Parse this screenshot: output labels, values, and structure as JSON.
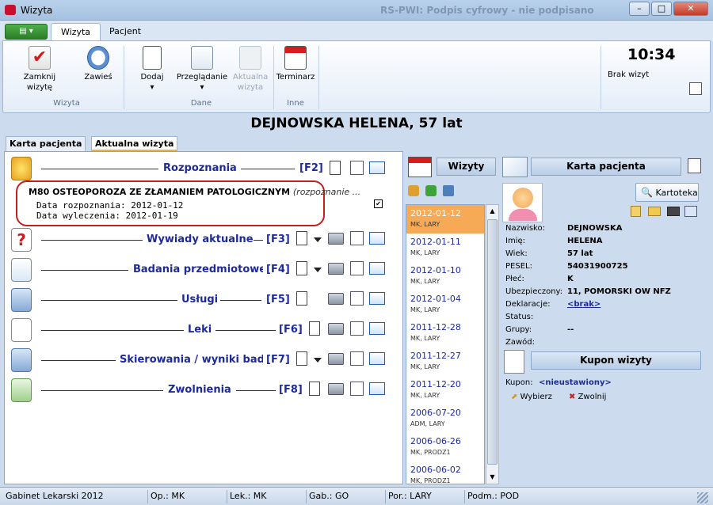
{
  "window": {
    "title": "Wizyta",
    "background_title": "RS-PWI: Podpis cyfrowy - nie podpisano"
  },
  "ribbon": {
    "tabs": [
      "Wizyta",
      "Pacjent"
    ],
    "buttons": {
      "zamknij": "Zamknij wizytę",
      "zawies": "Zawieś",
      "dodaj": "Dodaj",
      "przegladanie": "Przeglądanie",
      "aktualna1": "Aktualna",
      "aktualna2": "wizyta",
      "terminarz": "Terminarz"
    },
    "groups": {
      "wizyta": "Wizyta",
      "dane": "Dane",
      "inne": "Inne"
    },
    "clock": "10:34",
    "status": "Brak wizyt"
  },
  "patient": {
    "header": "DEJNOWSKA HELENA, 57 lat"
  },
  "patient_tabs": [
    "Karta pacjenta",
    "Aktualna wizyta"
  ],
  "sections": [
    {
      "label": "Rozpoznania",
      "key": "[F2]"
    },
    {
      "label": "Wywiady aktualne",
      "key": "[F3]"
    },
    {
      "label": "Badania przedmiotowe",
      "key": "[F4]"
    },
    {
      "label": "Usługi",
      "key": "[F5]"
    },
    {
      "label": "Leki",
      "key": "[F6]"
    },
    {
      "label": "Skierowania / wyniki badań",
      "key": "[F7]"
    },
    {
      "label": "Zwolnienia",
      "key": "[F8]"
    }
  ],
  "diagnosis": {
    "title": "M80 OSTEOPOROZA ZE ZŁAMANIEM PATOLOGICZNYM",
    "note": "(rozpoznanie ...",
    "rozpoznanie": "Data rozpoznania: 2012-01-12",
    "wyleczenie": "Data wyleczenia: 2012-01-19"
  },
  "visits": {
    "title": "Wizyty",
    "items": [
      {
        "date": "2012-01-12",
        "code": "MK, LARY",
        "selected": true
      },
      {
        "date": "2012-01-11",
        "code": "MK, LARY"
      },
      {
        "date": "2012-01-10",
        "code": "MK, LARY"
      },
      {
        "date": "2012-01-04",
        "code": "MK, LARY"
      },
      {
        "date": "2011-12-28",
        "code": "MK, LARY"
      },
      {
        "date": "2011-12-27",
        "code": "MK, LARY"
      },
      {
        "date": "2011-12-20",
        "code": "MK, LARY"
      },
      {
        "date": "2006-07-20",
        "code": "ADM, LARY"
      },
      {
        "date": "2006-06-26",
        "code": "MK, PRODZ1"
      },
      {
        "date": "2006-06-02",
        "code": "MK, PRODZ1"
      }
    ]
  },
  "karta": {
    "title": "Karta pacjenta",
    "kartoteka": "Kartoteka",
    "fields": [
      {
        "label": "Nazwisko:",
        "value": "DEJNOWSKA"
      },
      {
        "label": "Imię:",
        "value": "HELENA"
      },
      {
        "label": "Wiek:",
        "value": "57 lat"
      },
      {
        "label": "PESEL:",
        "value": "54031900725"
      },
      {
        "label": "Płeć:",
        "value": "K"
      },
      {
        "label": "Ubezpieczony:",
        "value": "11, POMORSKI OW NFZ"
      },
      {
        "label": "Deklaracje:",
        "value": "<brak>"
      },
      {
        "label": "Status:",
        "value": ""
      },
      {
        "label": "Grupy:",
        "value": "--"
      },
      {
        "label": "Zawód:",
        "value": ""
      }
    ]
  },
  "kupon": {
    "title": "Kupon wizyty",
    "label": "Kupon:",
    "value": "<nieustawiony>",
    "wybierz": "Wybierz",
    "zwolnij": "Zwolnij"
  },
  "statusbar": {
    "app": "Gabinet Lekarski 2012",
    "op": "Op.: MK",
    "lek": "Lek.: MK",
    "gab": "Gab.: GO",
    "por": "Por.: LARY",
    "podm": "Podm.: POD"
  },
  "colors": {
    "accent_blue": "#1d2a9c",
    "selected_visit": "#f7aa55",
    "diagnosis_outline": "#c41f1f"
  }
}
